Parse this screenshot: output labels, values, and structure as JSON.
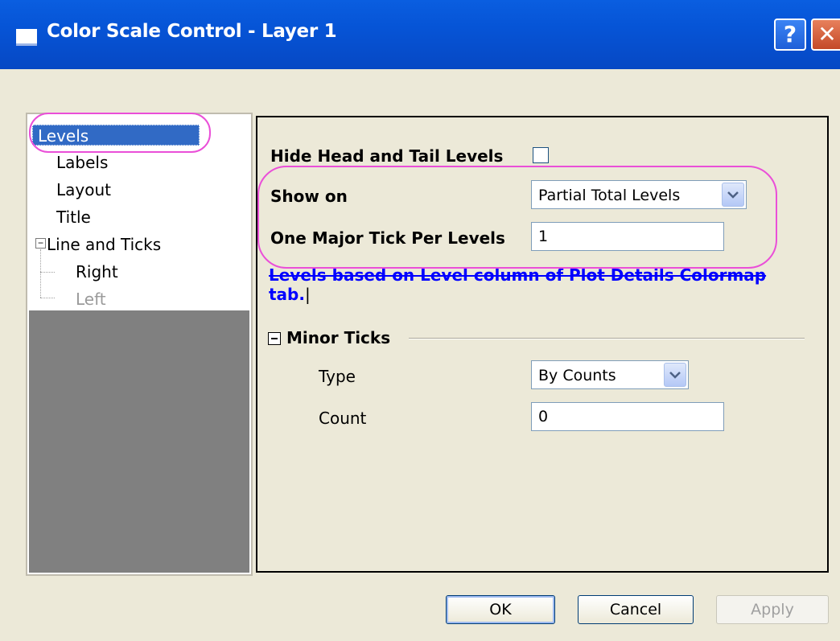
{
  "window": {
    "title": "Color Scale Control - Layer 1",
    "help_glyph": "?",
    "close_glyph": "✕"
  },
  "tree": {
    "items": [
      {
        "label": "Levels",
        "selected": true
      },
      {
        "label": "Labels"
      },
      {
        "label": "Layout"
      },
      {
        "label": "Title"
      },
      {
        "label": "Line and Ticks",
        "expanded": true,
        "toggle": "−"
      },
      {
        "label": "Right"
      },
      {
        "label": "Left",
        "disabled": true
      }
    ]
  },
  "levels": {
    "hide_head_tail_label": "Hide Head and Tail Levels",
    "hide_head_tail_checked": false,
    "show_on_label": "Show on",
    "show_on_value": "Partial Total Levels",
    "major_tick_label": "One Major Tick Per Levels",
    "major_tick_value": "1",
    "info_text": "Levels based on Level column of Plot Details Colormap",
    "info_text2": "tab."
  },
  "minor_ticks": {
    "section_title": "Minor Ticks",
    "type_label": "Type",
    "type_value": "By Counts",
    "count_label": "Count",
    "count_value": "0"
  },
  "buttons": {
    "ok": "OK",
    "cancel": "Cancel",
    "apply": "Apply"
  },
  "colors": {
    "titlebar": "#0654d6",
    "selection": "#316ac5",
    "highlight": "#ea4fd8",
    "info_text": "#0000ff"
  }
}
